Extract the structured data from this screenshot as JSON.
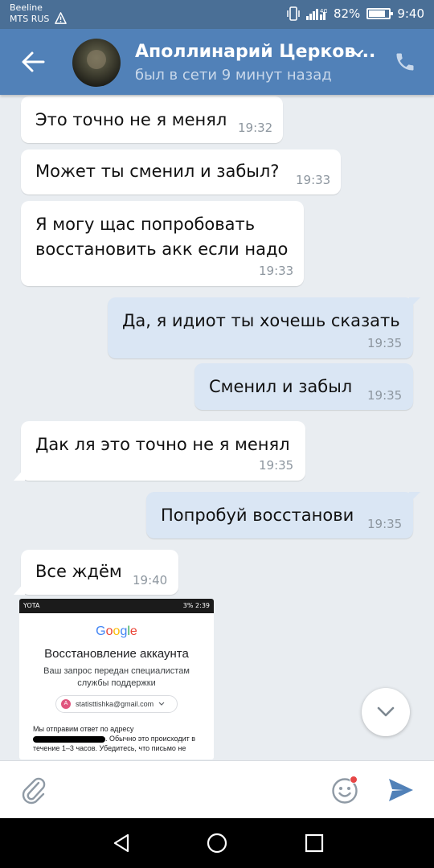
{
  "status_bar": {
    "carrier_line1": "Beeline",
    "carrier_line2": "MTS RUS",
    "network": "4G",
    "battery": "82%",
    "battery_level": 0.82,
    "time": "9:40"
  },
  "header": {
    "contact_name": "Аполлинарий Церков...",
    "last_seen": "был в сети 9 минут назад"
  },
  "messages": [
    {
      "direction": "in",
      "text": "Это точно не я менял",
      "time": "19:32"
    },
    {
      "direction": "in",
      "text": "Может ты сменил и забыл?",
      "time": "19:33"
    },
    {
      "direction": "in",
      "text_line1": "Я могу щас попробовать",
      "text_line2": "восстановить акк если надо",
      "time": "19:33"
    },
    {
      "direction": "out",
      "text": "Да, я идиот ты хочешь сказать",
      "time": "19:35"
    },
    {
      "direction": "out",
      "text": "Сменил и забыл",
      "time": "19:35"
    },
    {
      "direction": "in",
      "text": "Дак ля это точно не я менял",
      "time": "19:35"
    },
    {
      "direction": "out",
      "text": "Попробуй восстанови",
      "time": "19:35"
    },
    {
      "direction": "in",
      "text": "Все ждём",
      "time": "19:40"
    }
  ],
  "attachment": {
    "status_left": "YOTA",
    "status_right": "3% 2:39",
    "logo": "Google",
    "title": "Восстановление аккаунта",
    "subtitle": "Ваш запрос передан специалистам службы поддержки",
    "account_initial": "A",
    "account_email": "statisttishka@gmail.com",
    "note_line1": "Мы отправим ответ по адресу",
    "note_line2": ". Обычно это происходит в",
    "note_line3": "течение 1–3 часов. Убедитесь, что письмо не"
  },
  "composer": {
    "placeholder": ""
  },
  "icons": [
    "back-arrow-icon",
    "chevron-down-icon",
    "phone-icon",
    "attach-icon",
    "emoji-icon",
    "send-icon",
    "scroll-down-icon"
  ],
  "colors": {
    "header_bg": "#5181b8",
    "status_bg": "#4a6f96",
    "chat_bg": "#e9edf1",
    "incoming_bubble": "#ffffff",
    "outgoing_bubble": "#dae6f4",
    "send_accent": "#5181b8",
    "notification_dot": "#e64646"
  }
}
